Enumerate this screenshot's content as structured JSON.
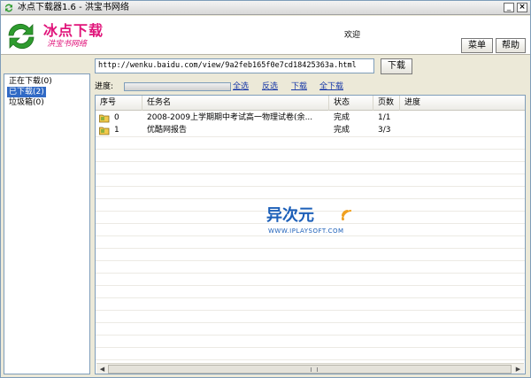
{
  "window": {
    "title": "冰点下载器1.6 - 洪宝书网络",
    "minimize_glyph": "_",
    "close_glyph": "×"
  },
  "header": {
    "brand": "冰点下载",
    "brand_sub": "洪宝书网络",
    "welcome": "欢迎",
    "menu_label": "菜单",
    "help_label": "帮助"
  },
  "sidebar": {
    "items": [
      {
        "label": "正在下载(0)",
        "selected": false
      },
      {
        "label": "已下载(2)",
        "selected": true
      },
      {
        "label": "垃圾箱(0)",
        "selected": false
      }
    ]
  },
  "toolbar": {
    "url_value": "http://wenku.baidu.com/view/9a2feb165f0e7cd18425363a.html",
    "download_label": "下载",
    "progress_label": "进度:",
    "progress_fraction": 0,
    "select_all": "全选",
    "invert_select": "反选",
    "download_link": "下载",
    "download_all": "全下载"
  },
  "list": {
    "columns": [
      "序号",
      "任务名",
      "状态",
      "页数",
      "进度"
    ],
    "rows": [
      {
        "index": "0",
        "name": "2008-2009上学期期中考试高一物理试卷(余...",
        "status": "完成",
        "pages": "1/1",
        "progress": ""
      },
      {
        "index": "1",
        "name": "优酷网报告",
        "status": "完成",
        "pages": "3/3",
        "progress": ""
      }
    ]
  },
  "watermark": {
    "text": "异次元",
    "sub": "WWW.IPLAYSOFT.COM"
  },
  "colors": {
    "brand": "#e0147a",
    "selection": "#316ac5",
    "link": "#1a3aa8",
    "icon_green": "#2e9b2e",
    "watermark": "#1c5fb8"
  },
  "icons": {
    "app": "refresh-arrows-icon",
    "logo": "refresh-arrows-icon",
    "row": "folder-icon",
    "watermark": "signal-wave-icon"
  }
}
